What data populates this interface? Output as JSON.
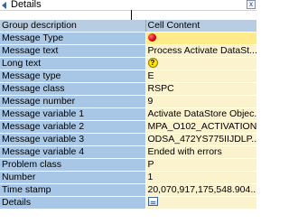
{
  "window": {
    "title": "Details",
    "close_label": "x"
  },
  "table": {
    "headers": [
      "Group description",
      "Cell Content"
    ],
    "rows": [
      {
        "label": "Message Type",
        "value": "",
        "icon": "red-light-icon"
      },
      {
        "label": "Message text",
        "value": "Process Activate DataSt..."
      },
      {
        "label": "Long text",
        "value": "",
        "icon": "help-question-icon"
      },
      {
        "label": "Message type",
        "value": "E"
      },
      {
        "label": "Message class",
        "value": "RSPC"
      },
      {
        "label": "Message number",
        "value": "9"
      },
      {
        "label": "Message variable 1",
        "value": "Activate DataStore Objec..."
      },
      {
        "label": "Message variable 2",
        "value": "MPA_O102_ACTIVATION"
      },
      {
        "label": "Message variable 3",
        "value": "ODSA_472YS775IIJDLP..."
      },
      {
        "label": "Message variable 4",
        "value": "Ended with errors"
      },
      {
        "label": "Problem class",
        "value": "P"
      },
      {
        "label": "Number",
        "value": "1"
      },
      {
        "label": "Time stamp",
        "value": "20,070,917,175,548.904..."
      },
      {
        "label": "Details",
        "value": "",
        "icon": "details-icon"
      }
    ]
  },
  "colors": {
    "header_bg": "#b8cde2",
    "label_bg": "#a8c7e6",
    "value_bg": "#fbf3ce",
    "selected_value_bg": "#ffeb8a"
  }
}
